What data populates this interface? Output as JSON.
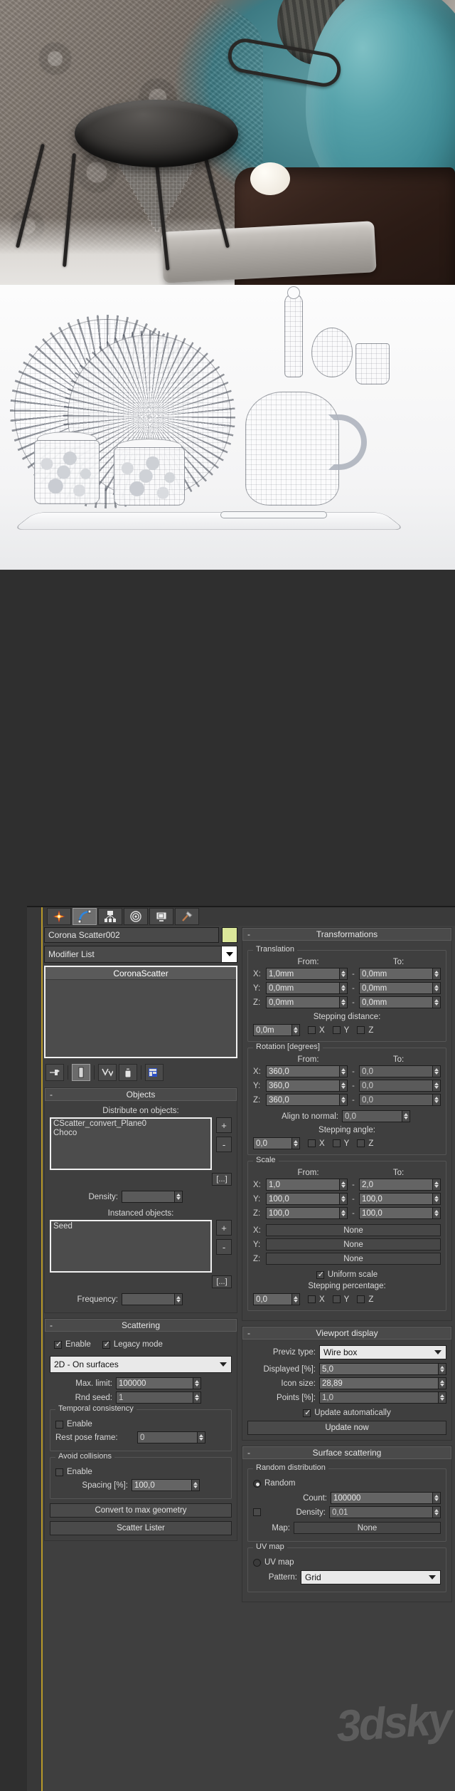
{
  "photos": {
    "photo1": {
      "caption": "kitchen strainer product render with teal vase and chocolate cake"
    },
    "photo2": {
      "caption": "wireframe clay render of plates, rolling pin, jug, jars on tray"
    }
  },
  "ui": {
    "app": "3ds Max Command Panel",
    "tabs": [
      {
        "name": "create-tab",
        "icon": "star-icon",
        "active": false
      },
      {
        "name": "modify-tab",
        "icon": "curve-icon",
        "active": true
      },
      {
        "name": "hierarchy-tab",
        "icon": "hierarchy-icon",
        "active": false
      },
      {
        "name": "motion-tab",
        "icon": "motion-icon",
        "active": false
      },
      {
        "name": "display-tab",
        "icon": "display-icon",
        "active": false
      },
      {
        "name": "utilities-tab",
        "icon": "hammer-icon",
        "active": false
      }
    ],
    "object_name": "Corona Scatter002",
    "modifier_list_label": "Modifier List",
    "modifier_stack": [
      "CoronaScatter"
    ],
    "stack_tools": [
      {
        "name": "pin-stack-icon",
        "glyph": "⊷"
      },
      {
        "name": "show-end-result-icon",
        "glyph": "▯"
      },
      {
        "name": "make-unique-icon",
        "glyph": "⋎"
      },
      {
        "name": "remove-modifier-icon",
        "glyph": "🗑"
      },
      {
        "name": "configure-modifier-sets-icon",
        "glyph": "▤"
      }
    ],
    "objects": {
      "title": "Objects",
      "distribute_label": "Distribute on objects:",
      "distribute_items": [
        "CScatter_convert_Plane0",
        "Choco"
      ],
      "add_label": "+",
      "remove_label": "-",
      "dots_label": "[...]",
      "density_label": "Density:",
      "density_value": "",
      "instanced_label": "Instanced objects:",
      "instanced_items": [
        "Seed"
      ],
      "frequency_label": "Frequency:",
      "frequency_value": ""
    },
    "scattering": {
      "title": "Scattering",
      "enable_label": "Enable",
      "enable_checked": true,
      "legacy_label": "Legacy mode",
      "legacy_checked": true,
      "mode": "2D - On surfaces",
      "max_limit_label": "Max. limit:",
      "max_limit_value": "100000",
      "rnd_seed_label": "Rnd seed:",
      "rnd_seed_value": "1",
      "temporal_title": "Temporal consistency",
      "temporal_enable_label": "Enable",
      "temporal_enable_checked": false,
      "rest_pose_label": "Rest pose frame:",
      "rest_pose_value": "0",
      "avoid_title": "Avoid collisions",
      "avoid_enable_label": "Enable",
      "avoid_enable_checked": false,
      "spacing_label": "Spacing [%]:",
      "spacing_value": "100,0",
      "convert_button": "Convert to max geometry",
      "lister_button": "Scatter Lister"
    },
    "transformations": {
      "title": "Transformations",
      "translation": {
        "title": "Translation",
        "from_label": "From:",
        "to_label": "To:",
        "rows": [
          {
            "axis": "X:",
            "from": "1,0mm",
            "to": "0,0mm"
          },
          {
            "axis": "Y:",
            "from": "0,0mm",
            "to": "0,0mm"
          },
          {
            "axis": "Z:",
            "from": "0,0mm",
            "to": "0,0mm"
          }
        ],
        "stepping_label": "Stepping distance:",
        "stepping_value": "0,0m",
        "axis_checks": [
          {
            "label": "X",
            "checked": false
          },
          {
            "label": "Y",
            "checked": false
          },
          {
            "label": "Z",
            "checked": false
          }
        ]
      },
      "rotation": {
        "title": "Rotation [degrees]",
        "from_label": "From:",
        "to_label": "To:",
        "rows": [
          {
            "axis": "X:",
            "from": "360,0",
            "to": "0,0"
          },
          {
            "axis": "Y:",
            "from": "360,0",
            "to": "0,0"
          },
          {
            "axis": "Z:",
            "from": "360,0",
            "to": "0,0"
          }
        ],
        "align_label": "Align to normal:",
        "align_value": "0,0",
        "stepping_label": "Stepping angle:",
        "stepping_value": "0,0",
        "axis_checks": [
          {
            "label": "X",
            "checked": false
          },
          {
            "label": "Y",
            "checked": false
          },
          {
            "label": "Z",
            "checked": false
          }
        ]
      },
      "scale": {
        "title": "Scale",
        "from_label": "From:",
        "to_label": "To:",
        "rows": [
          {
            "axis": "X:",
            "from": "1,0",
            "to": "2,0"
          },
          {
            "axis": "Y:",
            "from": "100,0",
            "to": "100,0"
          },
          {
            "axis": "Z:",
            "from": "100,0",
            "to": "100,0"
          }
        ],
        "map_rows": [
          {
            "axis": "X:",
            "value": "None"
          },
          {
            "axis": "Y:",
            "value": "None"
          },
          {
            "axis": "Z:",
            "value": "None"
          }
        ],
        "uniform_label": "Uniform scale",
        "uniform_checked": true,
        "stepping_label": "Stepping percentage:",
        "stepping_value": "0,0",
        "axis_checks": [
          {
            "label": "X",
            "checked": false
          },
          {
            "label": "Y",
            "checked": false
          },
          {
            "label": "Z",
            "checked": false
          }
        ]
      }
    },
    "viewport_display": {
      "title": "Viewport display",
      "previz_label": "Previz type:",
      "previz_value": "Wire box",
      "displayed_label": "Displayed [%]:",
      "displayed_value": "5,0",
      "icon_size_label": "Icon size:",
      "icon_size_value": "28,89",
      "points_label": "Points [%]:",
      "points_value": "1,0",
      "update_auto_label": "Update automatically",
      "update_auto_checked": true,
      "update_now_button": "Update now"
    },
    "surface_scattering": {
      "title": "Surface scattering",
      "random_group": "Random distribution",
      "random_label": "Random",
      "random_selected": true,
      "count_label": "Count:",
      "count_value": "100000",
      "density_label": "Density:",
      "density_value": "0,01",
      "density_checked": false,
      "map_label": "Map:",
      "map_value": "None",
      "uv_group": "UV map",
      "uv_label": "UV map",
      "uv_selected": false,
      "pattern_label": "Pattern:",
      "pattern_value": "Grid"
    }
  },
  "watermark": "3dsky",
  "colors": {
    "panel_bg": "#3f3f3f",
    "accent_yellow": "#b8992a",
    "color_chip": "#dbe79a",
    "teal_vase": "#57a3ab"
  }
}
